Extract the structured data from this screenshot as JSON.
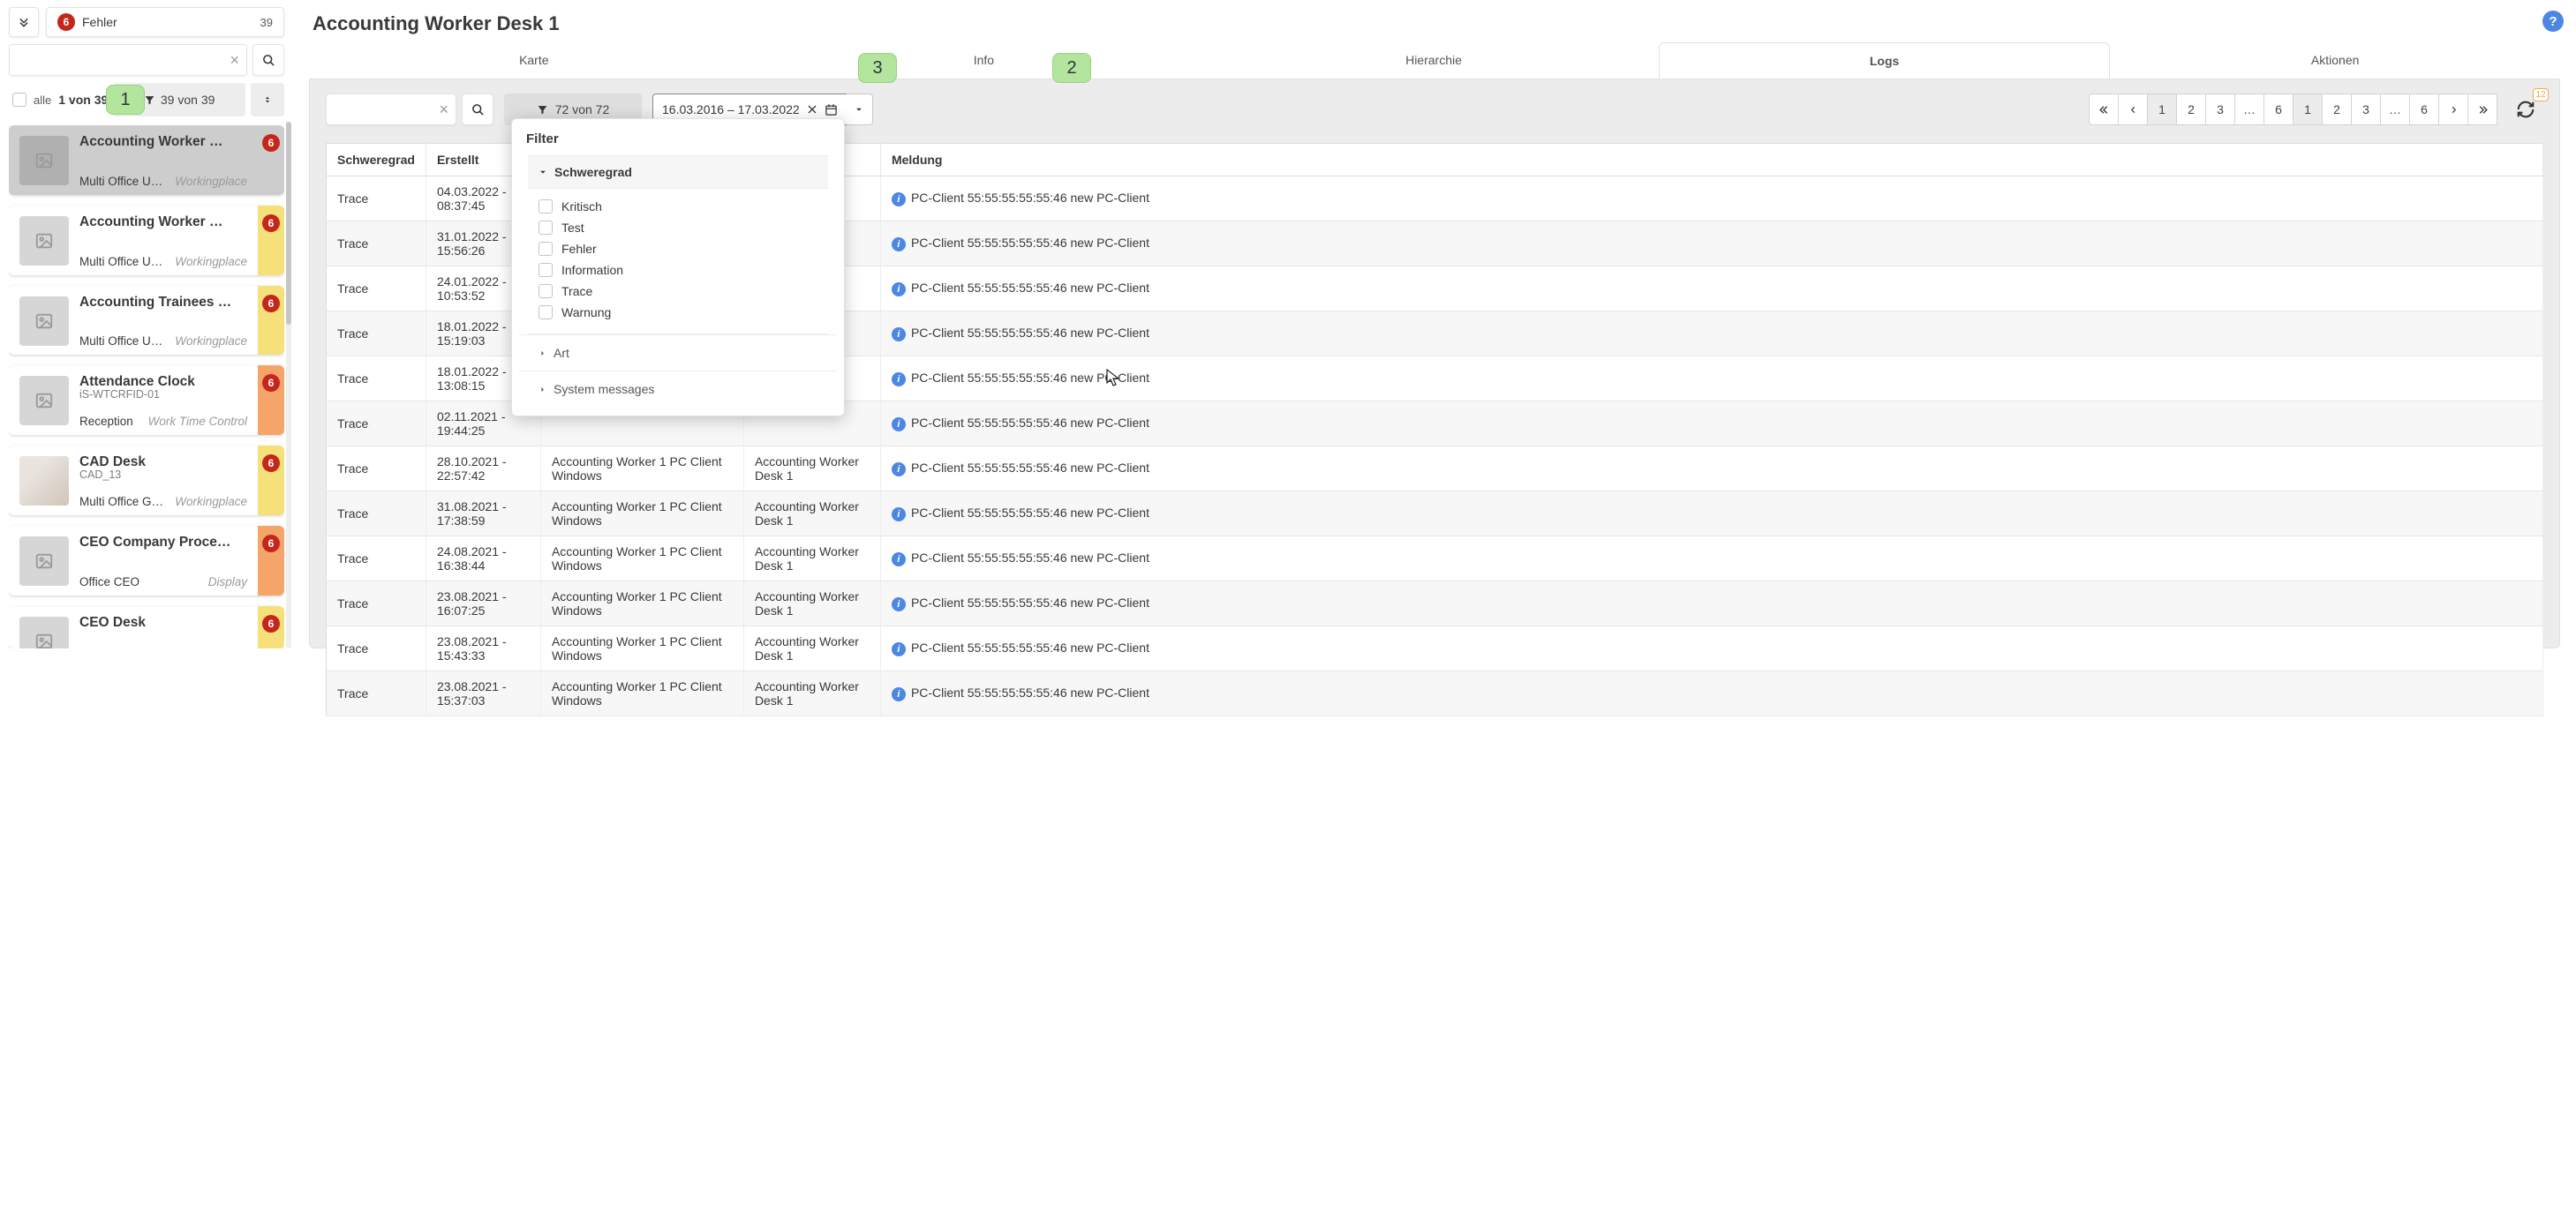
{
  "sidebar": {
    "errorChip": {
      "badge": "6",
      "label": "Fehler",
      "count": "39"
    },
    "alleLabel": "alle",
    "pageOf": "1 von 39",
    "filterCount": "39 von 39",
    "callout1": "1",
    "items": [
      {
        "title": "Accounting Worker …",
        "sub": "",
        "loc": "Multi Office U…",
        "tag": "Workingplace",
        "badge": "6",
        "stripe": "",
        "selected": true
      },
      {
        "title": "Accounting Worker …",
        "sub": "",
        "loc": "Multi Office U…",
        "tag": "Workingplace",
        "badge": "6",
        "stripe": "yellow",
        "selected": false
      },
      {
        "title": "Accounting Trainees …",
        "sub": "",
        "loc": "Multi Office U…",
        "tag": "Workingplace",
        "badge": "6",
        "stripe": "yellow",
        "selected": false
      },
      {
        "title": "Attendance Clock",
        "sub": "iS-WTCRFID-01",
        "loc": "Reception",
        "tag": "Work Time Control",
        "badge": "6",
        "stripe": "orange",
        "selected": false
      },
      {
        "title": "CAD Desk",
        "sub": "CAD_13",
        "loc": "Multi Office G…",
        "tag": "Workingplace",
        "badge": "6",
        "stripe": "yellow",
        "selected": false,
        "photo": true
      },
      {
        "title": "CEO Company Proce…",
        "sub": "",
        "loc": "Office CEO",
        "tag": "Display",
        "badge": "6",
        "stripe": "orange",
        "selected": false
      },
      {
        "title": "CEO Desk",
        "sub": "",
        "loc": "",
        "tag": "",
        "badge": "6",
        "stripe": "yellow",
        "selected": false,
        "partial": true
      }
    ]
  },
  "main": {
    "title": "Accounting Worker Desk 1",
    "tabs": [
      "Karte",
      "Info",
      "Hierarchie",
      "Logs",
      "Aktionen"
    ],
    "activeTab": 3,
    "callout2": "2",
    "callout3": "3",
    "toolbar": {
      "filterCount": "72 von 72",
      "dateRange": "16.03.2016 – 17.03.2022",
      "pages": [
        "1",
        "2",
        "3",
        "…",
        "6"
      ],
      "activePage": 0,
      "refreshBadge": "12"
    },
    "filterPopover": {
      "title": "Filter",
      "group1": {
        "title": "Schweregrad",
        "options": [
          "Kritisch",
          "Test",
          "Fehler",
          "Information",
          "Trace",
          "Warnung"
        ]
      },
      "closedGroups": [
        "Art",
        "System messages"
      ]
    },
    "table": {
      "headers": [
        "Schweregrad",
        "Erstellt",
        "",
        "",
        "Meldung"
      ],
      "rows": [
        {
          "sev": "Trace",
          "ts": "04.03.2022 - 08:37:45",
          "c3": "",
          "c4": "",
          "msg": "PC-Client 55:55:55:55:55:46 new PC-Client"
        },
        {
          "sev": "Trace",
          "ts": "31.01.2022 - 15:56:26",
          "c3": "",
          "c4": "",
          "msg": "PC-Client 55:55:55:55:55:46 new PC-Client"
        },
        {
          "sev": "Trace",
          "ts": "24.01.2022 - 10:53:52",
          "c3": "",
          "c4": "",
          "msg": "PC-Client 55:55:55:55:55:46 new PC-Client"
        },
        {
          "sev": "Trace",
          "ts": "18.01.2022 - 15:19:03",
          "c3": "",
          "c4": "",
          "msg": "PC-Client 55:55:55:55:55:46 new PC-Client"
        },
        {
          "sev": "Trace",
          "ts": "18.01.2022 - 13:08:15",
          "c3": "",
          "c4": "",
          "msg": "PC-Client 55:55:55:55:55:46 new PC-Client"
        },
        {
          "sev": "Trace",
          "ts": "02.11.2021 - 19:44:25",
          "c3": "",
          "c4": "",
          "msg": "PC-Client 55:55:55:55:55:46 new PC-Client"
        },
        {
          "sev": "Trace",
          "ts": "28.10.2021 - 22:57:42",
          "c3": "Accounting Worker 1 PC Client Windows",
          "c4": "Accounting Worker Desk 1",
          "msg": "PC-Client 55:55:55:55:55:46 new PC-Client"
        },
        {
          "sev": "Trace",
          "ts": "31.08.2021 - 17:38:59",
          "c3": "Accounting Worker 1 PC Client Windows",
          "c4": "Accounting Worker Desk 1",
          "msg": "PC-Client 55:55:55:55:55:46 new PC-Client"
        },
        {
          "sev": "Trace",
          "ts": "24.08.2021 - 16:38:44",
          "c3": "Accounting Worker 1 PC Client Windows",
          "c4": "Accounting Worker Desk 1",
          "msg": "PC-Client 55:55:55:55:55:46 new PC-Client"
        },
        {
          "sev": "Trace",
          "ts": "23.08.2021 - 16:07:25",
          "c3": "Accounting Worker 1 PC Client Windows",
          "c4": "Accounting Worker Desk 1",
          "msg": "PC-Client 55:55:55:55:55:46 new PC-Client"
        },
        {
          "sev": "Trace",
          "ts": "23.08.2021 - 15:43:33",
          "c3": "Accounting Worker 1 PC Client Windows",
          "c4": "Accounting Worker Desk 1",
          "msg": "PC-Client 55:55:55:55:55:46 new PC-Client"
        },
        {
          "sev": "Trace",
          "ts": "23.08.2021 - 15:37:03",
          "c3": "Accounting Worker 1 PC Client Windows",
          "c4": "Accounting Worker Desk 1",
          "msg": "PC-Client 55:55:55:55:55:46 new PC-Client"
        }
      ]
    }
  }
}
